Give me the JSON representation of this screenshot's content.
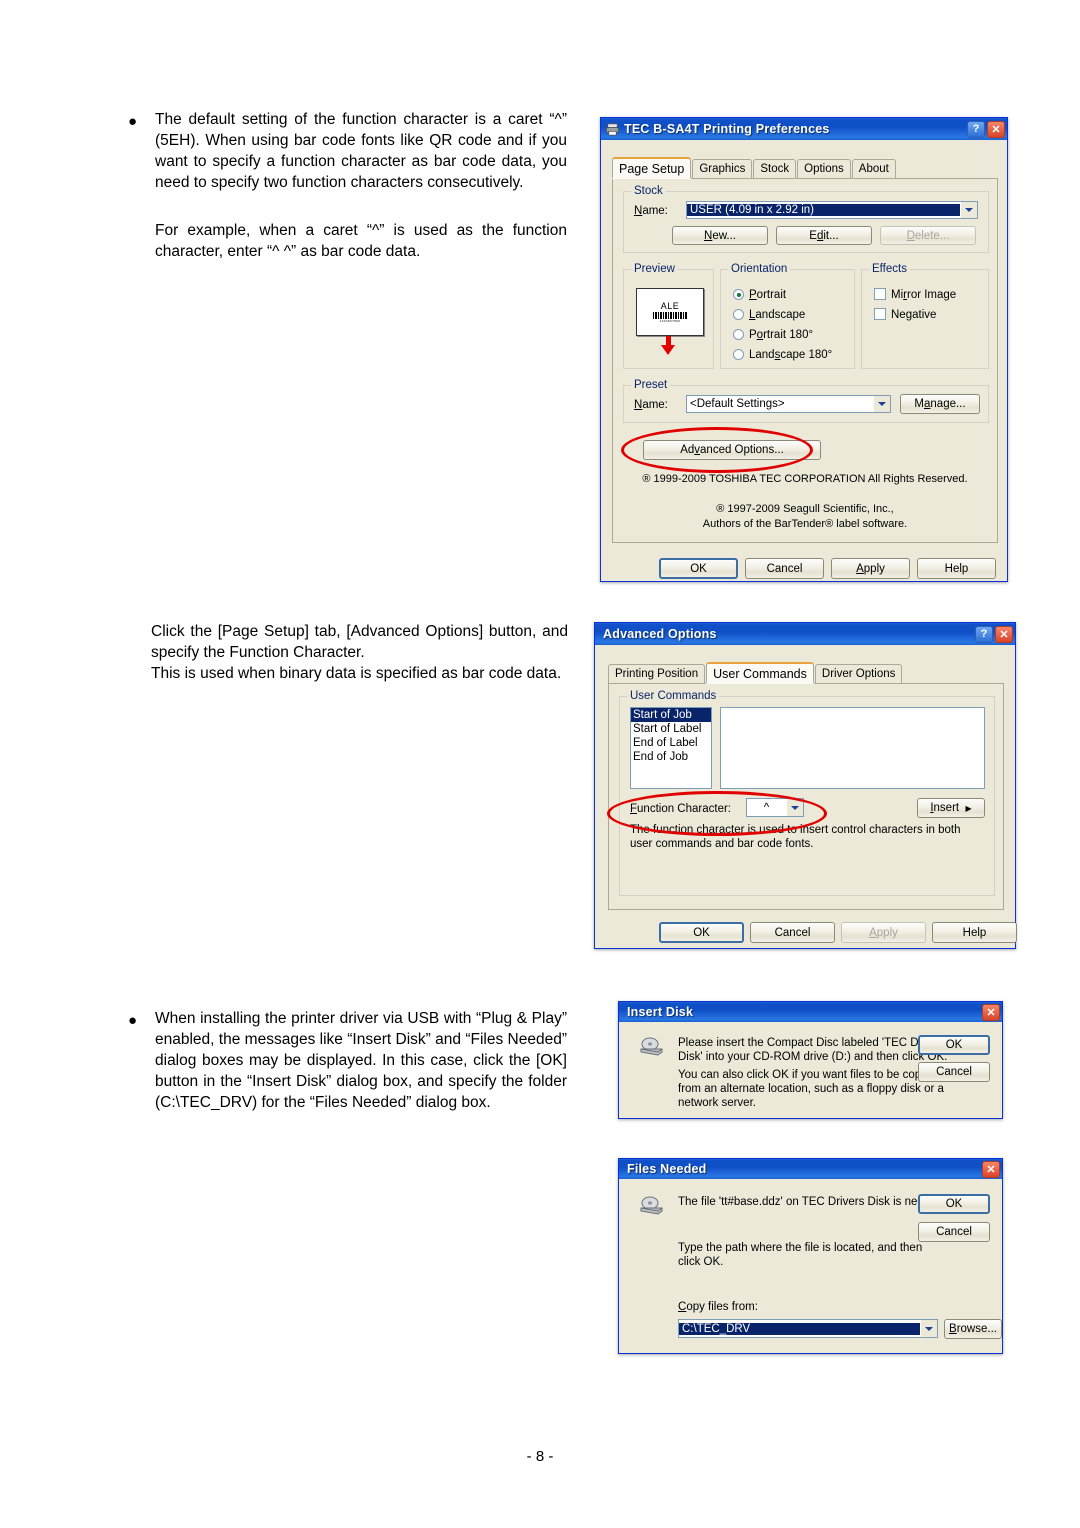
{
  "page": {
    "number": "- 8 -"
  },
  "body": {
    "bullet_glyph": "●",
    "para1": "The default setting of the function character is a caret “^” (5EH).  When using bar code fonts like QR code and if you want to specify a function character as bar code data, you need to specify two function characters consecutively.",
    "para2": "For example, when a caret “^” is used as the function character, enter “^ ^” as bar code data.",
    "para3": "Click the [Page Setup] tab, [Advanced Options] button, and specify the Function Character.",
    "para4": "This is used when binary data is specified as bar code data.",
    "para5": "When installing the printer driver via USB with “Plug & Play” enabled, the messages like “Insert Disk” and “Files Needed” dialog boxes may be displayed. In this case, click the [OK] button in the “Insert Disk” dialog box, and specify the folder (C:\\TEC_DRV) for the “Files Needed” dialog box."
  },
  "printing_preferences": {
    "title": "TEC B-SA4T Printing Preferences",
    "help_btn": "?",
    "close_btn": "✕",
    "tabs": [
      {
        "label": "Page Setup",
        "active": true
      },
      {
        "label": "Graphics",
        "active": false
      },
      {
        "label": "Stock",
        "active": false
      },
      {
        "label": "Options",
        "active": false
      },
      {
        "label": "About",
        "active": false
      }
    ],
    "stock_group": {
      "legend": "Stock",
      "name_label": "Name:",
      "name_value": "USER (4.09 in x 2.92 in)",
      "new_btn": "New...",
      "edit_btn": "Edit...",
      "delete_btn": "Delete..."
    },
    "preview_group": {
      "legend": "Preview",
      "card_text": "ALE",
      "card_barcode_text": "1234567890"
    },
    "orientation_group": {
      "legend": "Orientation",
      "options": [
        {
          "label": "Portrait",
          "selected": true
        },
        {
          "label": "Landscape",
          "selected": false
        },
        {
          "label": "Portrait 180°",
          "selected": false
        },
        {
          "label": "Landscape 180°",
          "selected": false
        }
      ]
    },
    "effects_group": {
      "legend": "Effects",
      "options": [
        {
          "label": "Mirror Image",
          "checked": false
        },
        {
          "label": "Negative",
          "checked": false
        }
      ]
    },
    "preset_group": {
      "legend": "Preset",
      "name_label": "Name:",
      "name_value": "<Default Settings>",
      "manage_btn": "Manage..."
    },
    "advanced_options_btn": "Advanced Options...",
    "copyright_line1": "® 1999-2009 TOSHIBA TEC CORPORATION All Rights Reserved.",
    "copyright_line2": "® 1997-2009 Seagull Scientific, Inc.,",
    "copyright_line3": "Authors of the BarTender® label software.",
    "buttons": {
      "ok": "OK",
      "cancel": "Cancel",
      "apply": "Apply",
      "help": "Help"
    }
  },
  "advanced_options": {
    "title": "Advanced Options",
    "help_btn": "?",
    "close_btn": "✕",
    "tabs": [
      {
        "label": "Printing Position",
        "active": false
      },
      {
        "label": "User Commands",
        "active": true
      },
      {
        "label": "Driver Options",
        "active": false
      }
    ],
    "user_commands_group": {
      "legend": "User Commands",
      "list": [
        {
          "label": "Start of Job",
          "selected": true
        },
        {
          "label": "Start of Label",
          "selected": false
        },
        {
          "label": "End of Label",
          "selected": false
        },
        {
          "label": "End of Job",
          "selected": false
        }
      ],
      "command_text": "",
      "function_character_label": "Function Character:",
      "function_character_value": "^",
      "insert_btn": "Insert",
      "insert_arrow": "▶",
      "hint": "The function character is used to insert control characters in both user commands and bar code fonts."
    },
    "buttons": {
      "ok": "OK",
      "cancel": "Cancel",
      "apply": "Apply",
      "help": "Help"
    }
  },
  "insert_disk": {
    "title": "Insert Disk",
    "close_btn": "✕",
    "message1": "Please insert the Compact Disc labeled 'TEC Drivers Disk' into your CD-ROM drive (D:) and then click OK.",
    "message2": "You can also click OK if you want files to be copied from an alternate location, such as a floppy disk or a network server.",
    "ok_btn": "OK",
    "cancel_btn": "Cancel"
  },
  "files_needed": {
    "title": "Files Needed",
    "close_btn": "✕",
    "message1": "The file 'tt#base.ddz' on TEC Drivers Disk is needed.",
    "message2": "Type the path where the file is located, and then click OK.",
    "copy_from_label": "Copy files from:",
    "copy_from_value": "C:\\TEC_DRV",
    "ok_btn": "OK",
    "cancel_btn": "Cancel",
    "browse_btn": "Browse..."
  }
}
